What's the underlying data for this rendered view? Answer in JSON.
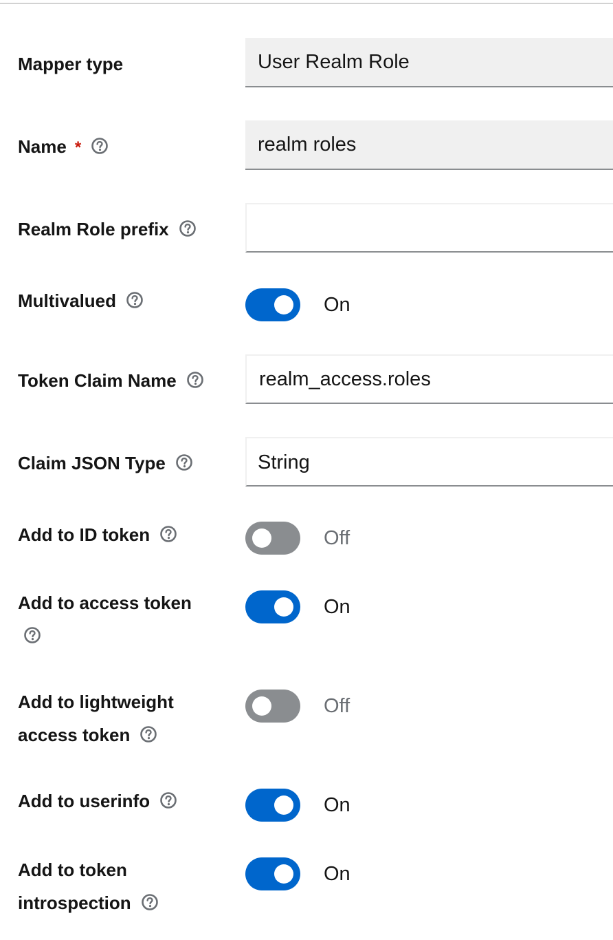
{
  "form": {
    "mapper_type": {
      "label": "Mapper type",
      "value": "User Realm Role"
    },
    "name": {
      "label": "Name",
      "required_mark": "*",
      "value": "realm roles"
    },
    "realm_role_prefix": {
      "label": "Realm Role prefix",
      "value": ""
    },
    "multivalued": {
      "label": "Multivalued",
      "enabled": true,
      "state_text": "On"
    },
    "token_claim_name": {
      "label": "Token Claim Name",
      "value": "realm_access.roles"
    },
    "claim_json_type": {
      "label": "Claim JSON Type",
      "value": "String"
    },
    "add_to_id_token": {
      "label": "Add to ID token",
      "enabled": false,
      "state_text": "Off"
    },
    "add_to_access_token": {
      "label": "Add to access token",
      "enabled": true,
      "state_text": "On"
    },
    "add_to_lightweight_access_token": {
      "label_line1": "Add to lightweight",
      "label_line2": "access token",
      "enabled": false,
      "state_text": "Off"
    },
    "add_to_userinfo": {
      "label": "Add to userinfo",
      "enabled": true,
      "state_text": "On"
    },
    "add_to_token_introspection": {
      "label_line1": "Add to token",
      "label_line2": "introspection",
      "enabled": true,
      "state_text": "On"
    }
  },
  "colors": {
    "switch_on": "#0066cc",
    "switch_off": "#8a8d90",
    "required": "#c9190b",
    "readonly_bg": "#f0f0f0"
  },
  "icons": {
    "help": "help-circle-icon"
  }
}
